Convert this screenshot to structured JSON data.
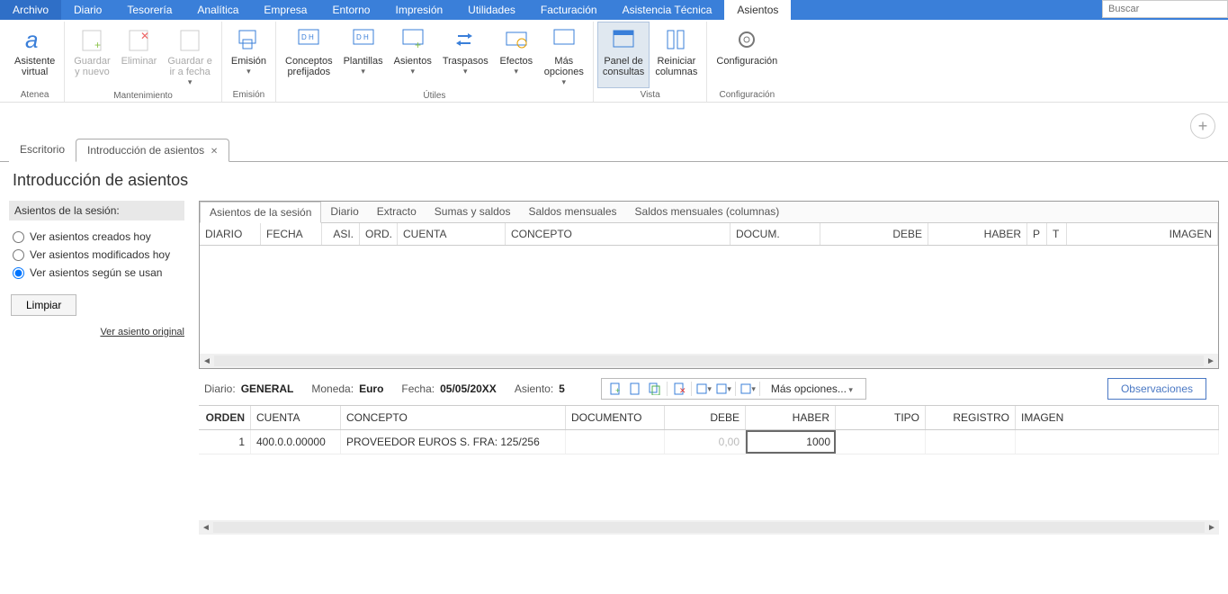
{
  "menu": {
    "items": [
      "Archivo",
      "Diario",
      "Tesorería",
      "Analítica",
      "Empresa",
      "Entorno",
      "Impresión",
      "Utilidades",
      "Facturación",
      "Asistencia Técnica",
      "Asientos"
    ],
    "active": "Asientos",
    "search_placeholder": "Buscar"
  },
  "ribbon": {
    "groups": {
      "atenea": {
        "title": "Atenea",
        "asistente": "Asistente\nvirtual"
      },
      "mantenimiento": {
        "title": "Mantenimiento",
        "guardar_nuevo": "Guardar\ny nuevo",
        "eliminar": "Eliminar",
        "guardar_fecha": "Guardar e\nir a fecha"
      },
      "emision": {
        "title": "Emisión",
        "emision": "Emisión"
      },
      "utiles": {
        "title": "Útiles",
        "conceptos": "Conceptos\nprefijados",
        "plantillas": "Plantillas",
        "asientos": "Asientos",
        "traspasos": "Traspasos",
        "efectos": "Efectos",
        "mas": "Más\nopciones"
      },
      "vista": {
        "title": "Vista",
        "panel": "Panel de\nconsultas",
        "reiniciar": "Reiniciar\ncolumnas"
      },
      "config": {
        "title": "Configuración",
        "config": "Configuración"
      }
    }
  },
  "docTabs": {
    "escritorio": "Escritorio",
    "intro": "Introducción de asientos"
  },
  "page": {
    "title": "Introducción de asientos"
  },
  "leftPanel": {
    "header": "Asientos de la sesión:",
    "opt_hoy": "Ver asientos creados hoy",
    "opt_mod": "Ver asientos modificados hoy",
    "opt_usan": "Ver asientos según se usan",
    "btn_limpiar": "Limpiar",
    "link": "Ver asiento original"
  },
  "sessionTabs": [
    "Asientos de la sesión",
    "Diario",
    "Extracto",
    "Sumas y saldos",
    "Saldos mensuales",
    "Saldos mensuales (columnas)"
  ],
  "sessionGrid": {
    "headers": [
      "DIARIO",
      "FECHA",
      "ASI.",
      "ORD.",
      "CUENTA",
      "CONCEPTO",
      "DOCUM.",
      "DEBE",
      "HABER",
      "P",
      "T",
      "IMAGEN"
    ]
  },
  "entryBar": {
    "diario_lbl": "Diario:",
    "diario_val": "GENERAL",
    "moneda_lbl": "Moneda:",
    "moneda_val": "Euro",
    "fecha_lbl": "Fecha:",
    "fecha_val": "05/05/20XX",
    "asiento_lbl": "Asiento:",
    "asiento_val": "5",
    "mas_opciones": "Más opciones...",
    "observaciones": "Observaciones"
  },
  "entryGrid": {
    "headers": [
      "ORDEN",
      "CUENTA",
      "CONCEPTO",
      "DOCUMENTO",
      "DEBE",
      "HABER",
      "TIPO",
      "REGISTRO",
      "IMAGEN"
    ],
    "row": {
      "orden": "1",
      "cuenta": "400.0.0.00000",
      "concepto": "PROVEEDOR EUROS S. FRA:  125/256",
      "documento": "",
      "debe": "0,00",
      "haber": "1000",
      "tipo": "",
      "registro": "",
      "imagen": ""
    }
  }
}
